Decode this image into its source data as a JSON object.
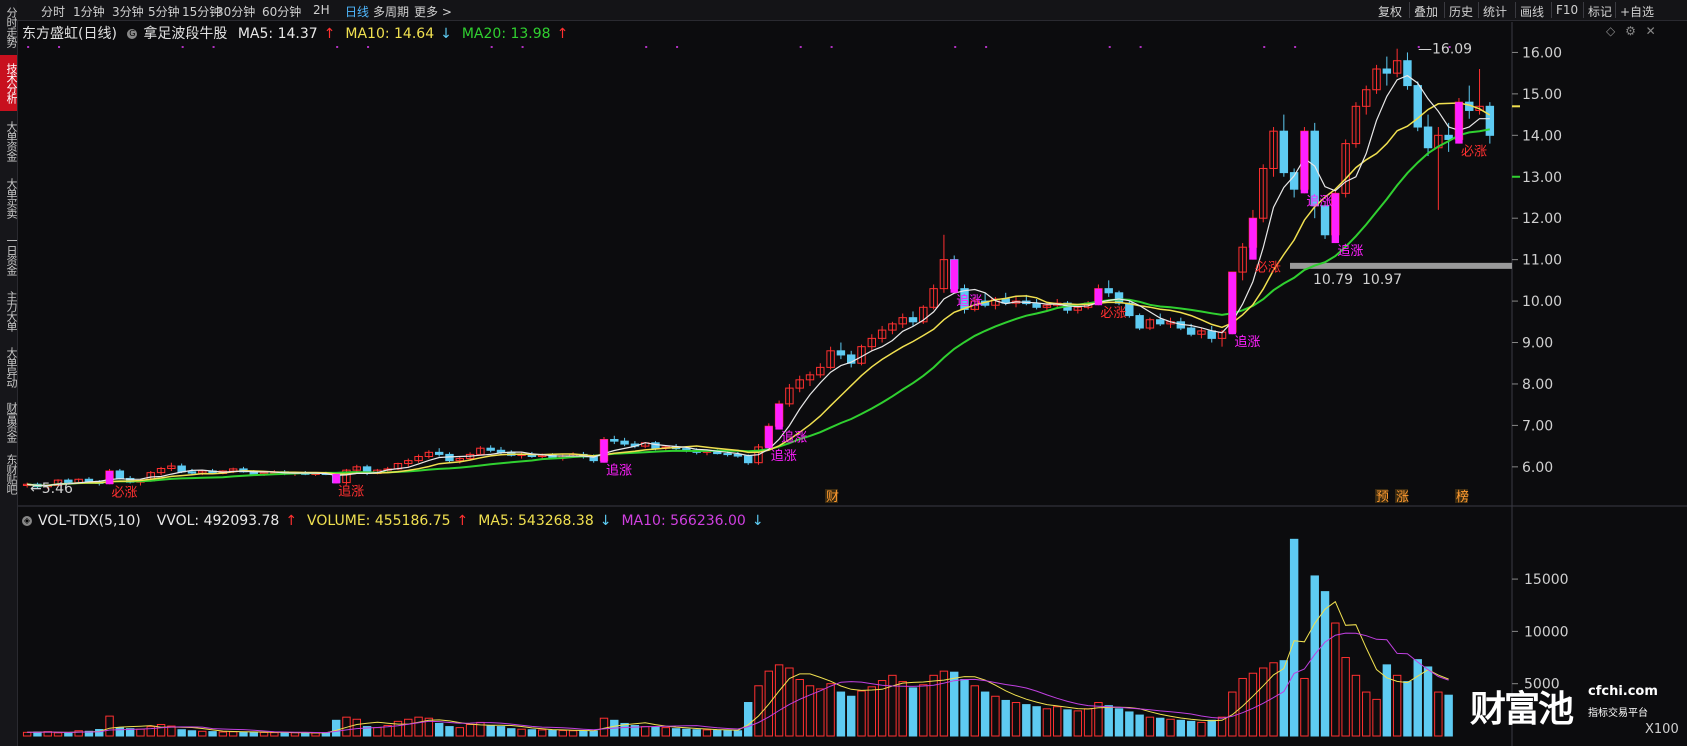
{
  "left_tabs": [
    "分时走势",
    "技术分析",
    "大单资金",
    "大单买卖",
    "一日资金",
    "主力大单",
    "大单异动",
    "财富资金",
    "东财贴吧"
  ],
  "left_active": 1,
  "timeframes": [
    "分时",
    "1分钟",
    "3分钟",
    "5分钟",
    "15分钟",
    "30分钟",
    "60分钟",
    "2H",
    "日线",
    "多周期",
    "更多 >"
  ],
  "timeframe_active": 8,
  "toolbar": [
    "复权",
    "叠加",
    "历史",
    "统计",
    "画线",
    "F10",
    "标记",
    "+自选"
  ],
  "stock": {
    "name": "东方盛虹(日线)",
    "indicator": "拿足波段牛股",
    "badge": "G"
  },
  "ma": [
    {
      "label": "MA5: 14.37",
      "arrow": "↑",
      "color": "#e8e8e8"
    },
    {
      "label": "MA10: 14.64",
      "arrow": "↓",
      "color": "#f0e050"
    },
    {
      "label": "MA20: 13.98",
      "arrow": "↑",
      "color": "#30d030"
    }
  ],
  "volume_bar": [
    {
      "label": "VOL-TDX(5,10)",
      "color": "#e8e8e8",
      "arrow": ""
    },
    {
      "label": "VVOL: 492093.78",
      "color": "#e8e8e8",
      "arrow": "↑"
    },
    {
      "label": "VOLUME: 455186.75",
      "color": "#f0e050",
      "arrow": "↑"
    },
    {
      "label": "MA5: 543268.38",
      "color": "#f0e050",
      "arrow": "↓"
    },
    {
      "label": "MA10: 566236.00",
      "color": "#d040e0",
      "arrow": "↓"
    }
  ],
  "price_axis": [
    "16.00",
    "15.00",
    "14.00",
    "13.00",
    "12.00",
    "11.00",
    "10.00",
    "9.00",
    "8.00",
    "7.00",
    "6.00"
  ],
  "volume_axis": [
    "15000",
    "10000",
    "5000"
  ],
  "volume_scale": "X100",
  "annotations": {
    "high": "16.09",
    "low": "5.46",
    "support_left": "10.79",
    "support_right": "10.97",
    "events": [
      "财",
      "预",
      "涨",
      "榜"
    ]
  },
  "signals": {
    "bizhang": "必涨",
    "zhuizhang": "追涨"
  },
  "watermark": {
    "main": "财富池",
    "domain": "cfchi.com",
    "sub": "指标交易平台"
  },
  "colors": {
    "up": "#ff3030",
    "down": "#5ecbf2",
    "ma5": "#e8e8e8",
    "ma10": "#f0e050",
    "ma20": "#30d030",
    "vma10": "#c040e0",
    "signal": "#ff20ff"
  },
  "chart_data": {
    "type": "candlestick",
    "title": "东方盛虹(日线)",
    "ylim": [
      5.2,
      16.3
    ],
    "candles": [
      [
        5.55,
        5.62,
        5.5,
        5.58
      ],
      [
        5.58,
        5.62,
        5.48,
        5.52
      ],
      [
        5.52,
        5.58,
        5.46,
        5.55
      ],
      [
        5.55,
        5.7,
        5.53,
        5.68
      ],
      [
        5.68,
        5.72,
        5.6,
        5.62
      ],
      [
        5.62,
        5.72,
        5.6,
        5.7
      ],
      [
        5.7,
        5.75,
        5.62,
        5.65
      ],
      [
        5.65,
        5.68,
        5.55,
        5.6
      ],
      [
        5.6,
        5.95,
        5.58,
        5.9
      ],
      [
        5.9,
        5.95,
        5.7,
        5.72
      ],
      [
        5.72,
        5.78,
        5.6,
        5.63
      ],
      [
        5.63,
        5.7,
        5.55,
        5.66
      ],
      [
        5.66,
        5.9,
        5.64,
        5.86
      ],
      [
        5.86,
        6.0,
        5.8,
        5.96
      ],
      [
        5.96,
        6.1,
        5.9,
        6.02
      ],
      [
        6.02,
        6.08,
        5.85,
        5.88
      ],
      [
        5.88,
        5.95,
        5.8,
        5.85
      ],
      [
        5.85,
        5.92,
        5.8,
        5.9
      ],
      [
        5.9,
        5.95,
        5.82,
        5.84
      ],
      [
        5.84,
        5.92,
        5.82,
        5.9
      ],
      [
        5.9,
        5.98,
        5.85,
        5.95
      ],
      [
        5.95,
        6.0,
        5.86,
        5.88
      ],
      [
        5.88,
        5.92,
        5.8,
        5.82
      ],
      [
        5.82,
        5.88,
        5.78,
        5.85
      ],
      [
        5.85,
        5.92,
        5.82,
        5.88
      ],
      [
        5.88,
        5.92,
        5.8,
        5.84
      ],
      [
        5.84,
        5.88,
        5.78,
        5.86
      ],
      [
        5.86,
        5.9,
        5.8,
        5.82
      ],
      [
        5.82,
        5.86,
        5.78,
        5.84
      ],
      [
        5.84,
        5.88,
        5.8,
        5.83
      ],
      [
        5.83,
        5.86,
        5.6,
        5.62
      ],
      [
        5.62,
        5.95,
        5.58,
        5.92
      ],
      [
        5.92,
        6.05,
        5.88,
        6.0
      ],
      [
        6.0,
        6.05,
        5.8,
        5.84
      ],
      [
        5.84,
        5.95,
        5.82,
        5.92
      ],
      [
        5.92,
        6.0,
        5.88,
        5.95
      ],
      [
        5.95,
        6.1,
        5.92,
        6.08
      ],
      [
        6.08,
        6.2,
        6.0,
        6.15
      ],
      [
        6.15,
        6.3,
        6.1,
        6.25
      ],
      [
        6.25,
        6.4,
        6.2,
        6.35
      ],
      [
        6.35,
        6.45,
        6.25,
        6.3
      ],
      [
        6.3,
        6.35,
        6.1,
        6.15
      ],
      [
        6.15,
        6.25,
        6.08,
        6.2
      ],
      [
        6.2,
        6.35,
        6.15,
        6.3
      ],
      [
        6.3,
        6.5,
        6.28,
        6.45
      ],
      [
        6.45,
        6.52,
        6.35,
        6.4
      ],
      [
        6.4,
        6.48,
        6.3,
        6.35
      ],
      [
        6.35,
        6.4,
        6.25,
        6.28
      ],
      [
        6.28,
        6.35,
        6.2,
        6.3
      ],
      [
        6.3,
        6.36,
        6.22,
        6.25
      ],
      [
        6.25,
        6.32,
        6.2,
        6.28
      ],
      [
        6.28,
        6.33,
        6.18,
        6.22
      ],
      [
        6.22,
        6.3,
        6.15,
        6.26
      ],
      [
        6.26,
        6.35,
        6.22,
        6.3
      ],
      [
        6.3,
        6.36,
        6.2,
        6.24
      ],
      [
        6.24,
        6.3,
        6.1,
        6.15
      ],
      [
        6.15,
        6.72,
        6.1,
        6.66
      ],
      [
        6.66,
        6.75,
        6.55,
        6.62
      ],
      [
        6.62,
        6.7,
        6.5,
        6.55
      ],
      [
        6.55,
        6.62,
        6.45,
        6.5
      ],
      [
        6.5,
        6.6,
        6.45,
        6.58
      ],
      [
        6.58,
        6.62,
        6.4,
        6.45
      ],
      [
        6.45,
        6.52,
        6.38,
        6.48
      ],
      [
        6.48,
        6.55,
        6.4,
        6.44
      ],
      [
        6.44,
        6.5,
        6.35,
        6.4
      ],
      [
        6.4,
        6.45,
        6.3,
        6.35
      ],
      [
        6.35,
        6.42,
        6.28,
        6.38
      ],
      [
        6.38,
        6.42,
        6.3,
        6.32
      ],
      [
        6.32,
        6.38,
        6.25,
        6.3
      ],
      [
        6.3,
        6.36,
        6.22,
        6.26
      ],
      [
        6.26,
        6.3,
        6.05,
        6.1
      ],
      [
        6.1,
        6.55,
        6.05,
        6.48
      ],
      [
        6.48,
        7.05,
        6.45,
        6.98
      ],
      [
        6.98,
        7.6,
        6.9,
        7.52
      ],
      [
        7.52,
        8.0,
        7.45,
        7.9
      ],
      [
        7.9,
        8.2,
        7.8,
        8.1
      ],
      [
        8.1,
        8.3,
        7.95,
        8.22
      ],
      [
        8.22,
        8.5,
        8.15,
        8.4
      ],
      [
        8.4,
        8.9,
        8.35,
        8.8
      ],
      [
        8.8,
        9.0,
        8.6,
        8.7
      ],
      [
        8.7,
        8.8,
        8.4,
        8.5
      ],
      [
        8.5,
        8.95,
        8.45,
        8.9
      ],
      [
        8.9,
        9.2,
        8.8,
        9.1
      ],
      [
        9.1,
        9.4,
        9.0,
        9.3
      ],
      [
        9.3,
        9.5,
        9.2,
        9.45
      ],
      [
        9.45,
        9.7,
        9.35,
        9.6
      ],
      [
        9.6,
        9.75,
        9.4,
        9.5
      ],
      [
        9.5,
        9.9,
        9.45,
        9.85
      ],
      [
        9.85,
        10.4,
        9.8,
        10.3
      ],
      [
        10.3,
        11.6,
        10.2,
        11.0
      ],
      [
        11.0,
        11.1,
        10.2,
        10.3
      ],
      [
        10.3,
        10.4,
        9.7,
        9.8
      ],
      [
        9.8,
        10.1,
        9.75,
        10.0
      ],
      [
        10.0,
        10.2,
        9.85,
        9.9
      ],
      [
        9.9,
        10.1,
        9.8,
        10.05
      ],
      [
        10.05,
        10.2,
        9.9,
        9.95
      ],
      [
        9.95,
        10.1,
        9.85,
        10.0
      ],
      [
        10.0,
        10.15,
        9.9,
        9.94
      ],
      [
        9.94,
        10.05,
        9.8,
        9.85
      ],
      [
        9.85,
        9.95,
        9.75,
        9.9
      ],
      [
        9.9,
        10.05,
        9.85,
        9.95
      ],
      [
        9.95,
        10.0,
        9.7,
        9.78
      ],
      [
        9.78,
        9.9,
        9.7,
        9.85
      ],
      [
        9.85,
        10.0,
        9.8,
        9.95
      ],
      [
        9.95,
        10.4,
        9.9,
        10.3
      ],
      [
        10.3,
        10.5,
        10.1,
        10.2
      ],
      [
        10.2,
        10.25,
        9.9,
        9.95
      ],
      [
        9.95,
        10.0,
        9.6,
        9.65
      ],
      [
        9.65,
        9.7,
        9.3,
        9.35
      ],
      [
        9.35,
        9.6,
        9.3,
        9.55
      ],
      [
        9.55,
        9.7,
        9.4,
        9.45
      ],
      [
        9.45,
        9.6,
        9.35,
        9.5
      ],
      [
        9.5,
        9.6,
        9.3,
        9.35
      ],
      [
        9.35,
        9.45,
        9.15,
        9.2
      ],
      [
        9.2,
        9.35,
        9.1,
        9.28
      ],
      [
        9.28,
        9.4,
        9.0,
        9.1
      ],
      [
        9.1,
        9.3,
        8.9,
        9.25
      ],
      [
        9.25,
        10.7,
        9.2,
        10.7
      ],
      [
        10.7,
        11.4,
        10.5,
        11.3
      ],
      [
        11.3,
        12.2,
        11.0,
        12.0
      ],
      [
        12.0,
        13.3,
        11.9,
        13.2
      ],
      [
        13.2,
        14.2,
        13.0,
        14.1
      ],
      [
        14.1,
        14.5,
        13.0,
        13.1
      ],
      [
        13.1,
        13.2,
        12.5,
        12.7
      ],
      [
        12.7,
        14.2,
        12.6,
        14.1
      ],
      [
        14.1,
        14.3,
        12.0,
        12.3
      ],
      [
        12.3,
        12.4,
        11.5,
        11.6
      ],
      [
        11.6,
        12.7,
        11.4,
        12.6
      ],
      [
        12.6,
        13.9,
        12.5,
        13.8
      ],
      [
        13.8,
        14.8,
        13.7,
        14.7
      ],
      [
        14.7,
        15.2,
        14.5,
        15.1
      ],
      [
        15.1,
        15.7,
        15.0,
        15.6
      ],
      [
        15.6,
        15.9,
        15.2,
        15.5
      ],
      [
        15.5,
        16.09,
        15.4,
        15.8
      ],
      [
        15.8,
        16.0,
        15.1,
        15.2
      ],
      [
        15.2,
        15.3,
        14.1,
        14.2
      ],
      [
        14.2,
        14.5,
        13.5,
        13.7
      ],
      [
        13.7,
        14.2,
        12.2,
        14.0
      ],
      [
        14.0,
        14.3,
        13.6,
        13.9
      ],
      [
        13.9,
        14.9,
        13.8,
        14.8
      ],
      [
        14.8,
        15.2,
        14.4,
        14.6
      ],
      [
        14.6,
        15.6,
        14.5,
        14.7
      ],
      [
        14.7,
        14.8,
        13.8,
        14.0
      ]
    ],
    "volumes": [
      350,
      380,
      420,
      300,
      280,
      500,
      450,
      620,
      1900,
      800,
      700,
      650,
      900,
      1100,
      950,
      600,
      500,
      450,
      420,
      380,
      400,
      380,
      360,
      340,
      320,
      300,
      310,
      290,
      280,
      300,
      1500,
      1800,
      1600,
      900,
      800,
      1000,
      1400,
      1600,
      1800,
      1700,
      1200,
      900,
      800,
      1100,
      1300,
      1000,
      900,
      700,
      650,
      600,
      580,
      550,
      520,
      500,
      480,
      460,
      1700,
      1500,
      1200,
      1000,
      900,
      850,
      800,
      700,
      650,
      600,
      580,
      550,
      520,
      500,
      3200,
      4800,
      6200,
      6800,
      6500,
      5400,
      4800,
      4500,
      5000,
      4200,
      3800,
      4300,
      4700,
      5300,
      5800,
      5200,
      4600,
      4900,
      5800,
      6200,
      6100,
      5400,
      4800,
      4200,
      3800,
      3400,
      3200,
      3000,
      2800,
      2600,
      2800,
      2500,
      2400,
      2600,
      3200,
      2900,
      2600,
      2300,
      2000,
      1800,
      1700,
      1600,
      1500,
      1400,
      1300,
      1500,
      1800,
      4200,
      5500,
      6000,
      6500,
      7000,
      7200,
      18800,
      5500,
      15300,
      13800,
      10800,
      7500,
      5800,
      4200,
      3500,
      6800,
      5800,
      5200,
      7300,
      6600,
      4200,
      3900
    ],
    "ma5_end": 14.37,
    "ma10_end": 14.64,
    "ma20_end": 13.98
  }
}
